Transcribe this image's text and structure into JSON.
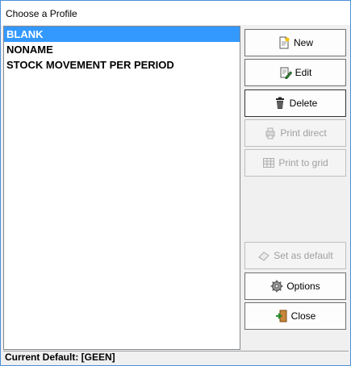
{
  "window": {
    "title": "Choose a Profile"
  },
  "profiles": [
    {
      "label": "BLANK",
      "selected": true
    },
    {
      "label": "NONAME",
      "selected": false
    },
    {
      "label": "STOCK MOVEMENT PER PERIOD",
      "selected": false
    }
  ],
  "buttons": {
    "new": {
      "label": "New",
      "icon": "new-document-icon",
      "enabled": true
    },
    "edit": {
      "label": "Edit",
      "icon": "edit-document-icon",
      "enabled": true
    },
    "delete": {
      "label": "Delete",
      "icon": "trash-icon",
      "enabled": true
    },
    "print_direct": {
      "label": "Print direct",
      "icon": "print-direct-icon",
      "enabled": false
    },
    "print_to_grid": {
      "label": "Print to grid",
      "icon": "grid-icon",
      "enabled": false
    },
    "set_as_default": {
      "label": "Set as default",
      "icon": "eraser-icon",
      "enabled": false
    },
    "options": {
      "label": "Options",
      "icon": "gear-icon",
      "enabled": true
    },
    "close": {
      "label": "Close",
      "icon": "door-exit-icon",
      "enabled": true
    }
  },
  "status": {
    "text": "Current Default: [GEEN]"
  },
  "colors": {
    "selection": "#3399ff",
    "window_border": "#4a90d9"
  }
}
